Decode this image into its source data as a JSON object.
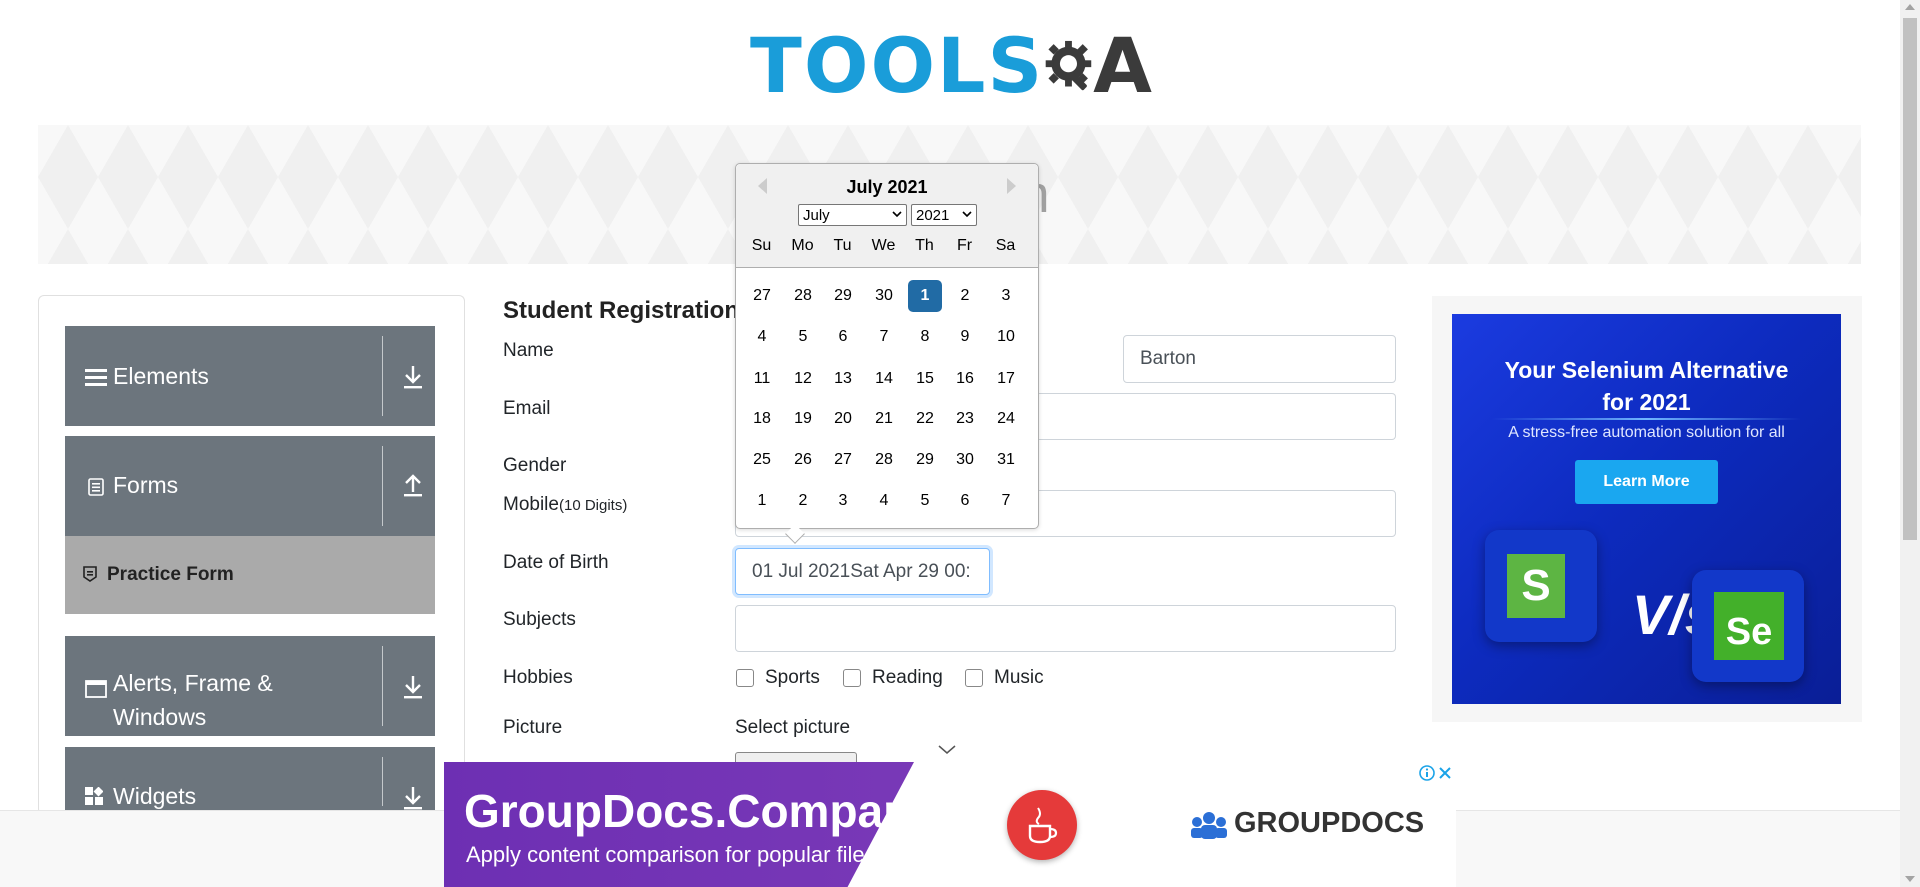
{
  "logo": {
    "part1": "TOOLS",
    "part2": "A"
  },
  "banner": {
    "title_visible": "orm"
  },
  "sidebar": {
    "groups": [
      {
        "label": "Elements",
        "icon": "hamburger-icon",
        "arrow": "download-icon"
      },
      {
        "label": "Forms",
        "icon": "document-icon",
        "arrow": "upload-icon"
      },
      {
        "label": "Alerts, Frame &",
        "label2": "Windows",
        "icon": "window-icon",
        "arrow": "download-icon"
      },
      {
        "label": "Widgets",
        "icon": "widgets-icon",
        "arrow": "download-icon"
      }
    ],
    "active_item": {
      "label": "Practice Form"
    }
  },
  "form": {
    "title": "Student Registration",
    "labels": {
      "name": "Name",
      "email": "Email",
      "gender": "Gender",
      "mobile": "Mobile",
      "mobile_hint": "(10 Digits)",
      "dob": "Date of Birth",
      "subjects": "Subjects",
      "hobbies": "Hobbies",
      "picture": "Picture"
    },
    "last_name_value": "Barton",
    "dob_value": "01 Jul 2021Sat Apr 29 00:",
    "hobbies": [
      "Sports",
      "Reading",
      "Music"
    ],
    "select_picture": "Select picture"
  },
  "datepicker": {
    "header": "July 2021",
    "month_select": "July",
    "year_select": "2021",
    "day_names": [
      "Su",
      "Mo",
      "Tu",
      "We",
      "Th",
      "Fr",
      "Sa"
    ],
    "weeks": [
      [
        "27",
        "28",
        "29",
        "30",
        "1",
        "2",
        "3"
      ],
      [
        "4",
        "5",
        "6",
        "7",
        "8",
        "9",
        "10"
      ],
      [
        "11",
        "12",
        "13",
        "14",
        "15",
        "16",
        "17"
      ],
      [
        "18",
        "19",
        "20",
        "21",
        "22",
        "23",
        "24"
      ],
      [
        "25",
        "26",
        "27",
        "28",
        "29",
        "30",
        "31"
      ],
      [
        "1",
        "2",
        "3",
        "4",
        "5",
        "6",
        "7"
      ]
    ],
    "selected": "1"
  },
  "ad_side": {
    "headline1": "Your Selenium Alternative",
    "headline2": "for 2021",
    "sub": "A stress-free automation solution for all",
    "button": "Learn More",
    "vs": "V/s",
    "tile1": "S",
    "tile2": "Se"
  },
  "ad_bottom": {
    "title": "GroupDocs.Comparison",
    "subtitle": "Apply content comparison for popular file formats",
    "brand": "GROUPDOCS"
  }
}
